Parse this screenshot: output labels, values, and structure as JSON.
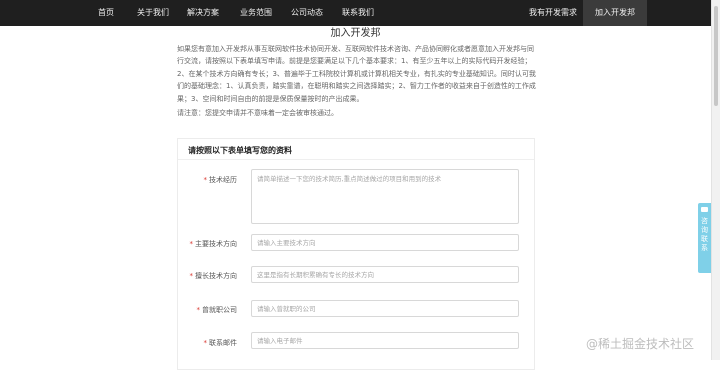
{
  "nav": {
    "items": [
      {
        "label": "首页"
      },
      {
        "label": "关于我们"
      },
      {
        "label": "解决方案"
      },
      {
        "label": "业务范围"
      },
      {
        "label": "公司动态"
      },
      {
        "label": "联系我们"
      }
    ],
    "right": [
      {
        "label": "我有开发需求"
      },
      {
        "label": "加入开发邦"
      }
    ]
  },
  "page": {
    "title": "加入开发邦",
    "intro": "如果您有意加入开发邦从事互联网软件技术协同开发、互联网软件技术咨询、产品协同孵化或者愿意加入开发邦与同行交流，请按照以下表单填写申请。前提是您要满足以下几个基本要求：1、有至少五年以上的实际代码开发经验；2、在某个技术方向确有专长；3、普遍毕于工科院校计算机或计算机相关专业，有扎实的专业基础知识。同时认可我们的基础理念：1、认真负责，踏实靠谱，在聪明和踏实之间选择踏实；2、智力工作者的收益来自于创造性的工作成果；3、空间和时间自由的前提是保质保量按时的产出成果。",
    "notice": "请注意：您提交申请并不意味着一定会被审核通过。"
  },
  "form": {
    "heading": "请按照以下表单填写您的资料",
    "required_mark": "*",
    "fields": [
      {
        "label": "技术经历",
        "placeholder": "请简单描述一下您的技术简历,重点简述做过的项目和用到的技术"
      },
      {
        "label": "主要技术方向",
        "placeholder": "请输入主要技术方向"
      },
      {
        "label": "擅长技术方向",
        "placeholder": "这里是指有长期积累确有专长的技术方向"
      },
      {
        "label": "曾就职公司",
        "placeholder": "请输入曾就职的公司"
      },
      {
        "label": "联系邮件",
        "placeholder": "请输入电子邮件"
      }
    ]
  },
  "side_tab": {
    "label": "咨询联系",
    "icon": "chat-icon"
  },
  "watermark": "@稀土掘金技术社区",
  "colors": {
    "nav_bg": "#1f1f1f",
    "required": "#d9362e",
    "side_tab": "#7fd0e8"
  }
}
